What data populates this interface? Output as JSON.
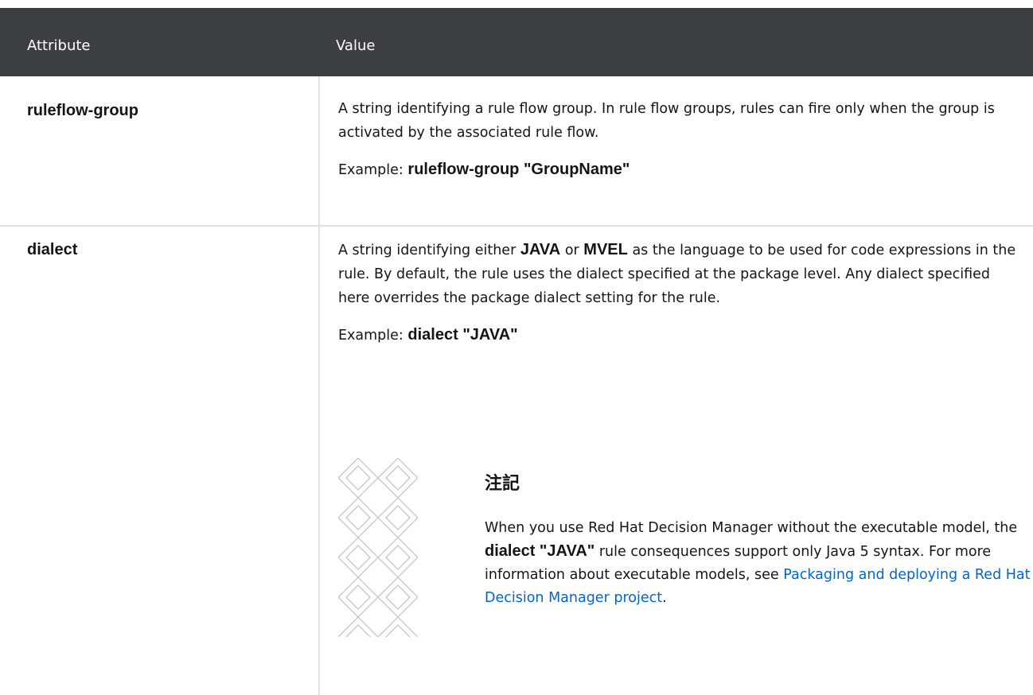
{
  "header": {
    "col_attribute": "Attribute",
    "col_value": "Value"
  },
  "rows": [
    {
      "name": "ruleflow-group",
      "description": "A string identifying a rule flow group. In rule flow groups, rules can fire only when the group is activated by the associated rule flow.",
      "example_label": "Example:",
      "example_code": "ruleflow-group \"GroupName\""
    },
    {
      "name": "dialect",
      "desc_part1": "A string identifying either",
      "desc_code1": "JAVA",
      "desc_part2": "or",
      "desc_code2": "MVEL",
      "desc_part3": "as the language to be used for code expressions in the rule. By default, the rule uses the dialect specified at the package level. Any dialect specified here overrides the package dialect setting for the rule.",
      "example_label": "Example:",
      "example_code": "dialect \"JAVA\"",
      "note": {
        "title": "注記",
        "text1": "When you use Red Hat Decision Manager without the executable model, the",
        "code": "dialect \"JAVA\"",
        "text2": "rule consequences support only Java 5 syntax. For more information about executable models, see",
        "link": "Packaging and deploying a Red Hat Decision Manager project",
        "text3": "."
      }
    }
  ]
}
